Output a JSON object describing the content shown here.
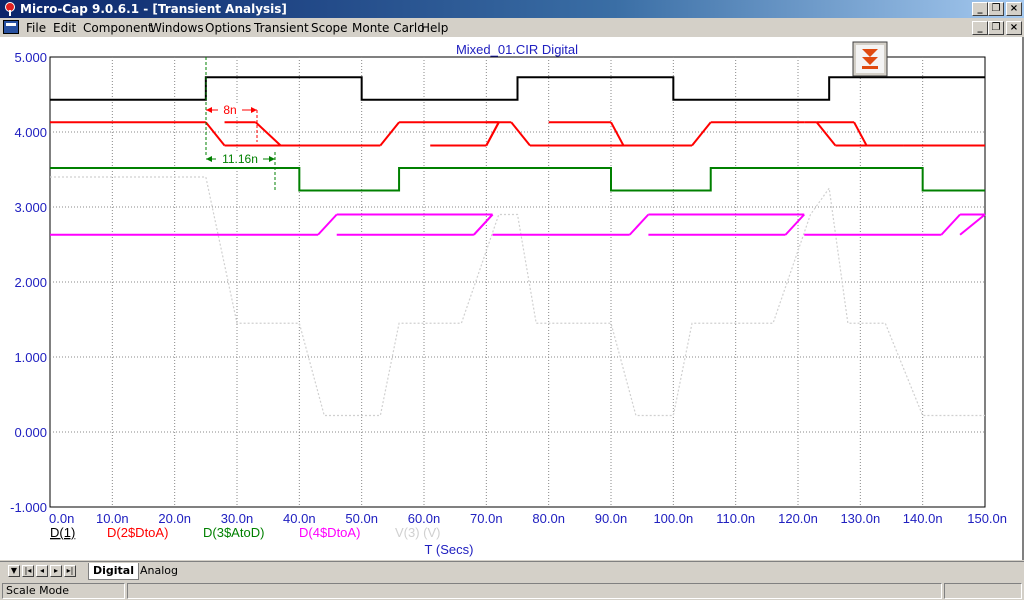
{
  "window": {
    "title": "Micro-Cap 9.0.6.1 - [Transient Analysis]"
  },
  "menu": [
    "File",
    "Edit",
    "Component",
    "Windows",
    "Options",
    "Transient",
    "Scope",
    "Monte Carlo",
    "Help"
  ],
  "plot": {
    "title": "Mixed_01.CIR Digital",
    "x_axis_label": "T (Secs)",
    "legend": [
      {
        "label": "D(1)",
        "color": "#000000"
      },
      {
        "label": "D(2$DtoA)",
        "color": "#ff0000"
      },
      {
        "label": "D(3$AtoD)",
        "color": "#008000"
      },
      {
        "label": "D(4$DtoA)",
        "color": "#ff00ff"
      },
      {
        "label": "V(3) (V)",
        "color": "#d0d0d0"
      }
    ],
    "annotations": {
      "delay1": "8n",
      "delay2": "11.16n"
    }
  },
  "chart_data": {
    "type": "line",
    "title": "Mixed_01.CIR Digital",
    "xlabel": "T (Secs)",
    "ylabel": "",
    "xlim": [
      0,
      150
    ],
    "ylim": [
      -1,
      5
    ],
    "x_ticks": [
      "0.0n",
      "10.0n",
      "20.0n",
      "30.0n",
      "40.0n",
      "50.0n",
      "60.0n",
      "70.0n",
      "80.0n",
      "90.0n",
      "100.0n",
      "110.0n",
      "120.0n",
      "130.0n",
      "140.0n",
      "150.0n"
    ],
    "y_ticks": [
      "5.000",
      "4.000",
      "3.000",
      "2.000",
      "1.000",
      "0.000",
      "-1.000"
    ],
    "grid": true,
    "series": [
      {
        "name": "D(1)",
        "color": "#000000",
        "x": [
          0,
          25,
          25,
          50,
          50,
          75,
          75,
          100,
          100,
          125,
          125,
          150
        ],
        "y": [
          4.43,
          4.43,
          4.73,
          4.73,
          4.43,
          4.43,
          4.73,
          4.73,
          4.43,
          4.43,
          4.73,
          4.73
        ]
      },
      {
        "name": "D(2$DtoA)",
        "color": "#ff0000",
        "dual": true,
        "x": [
          0,
          25,
          28,
          33,
          37,
          40,
          53,
          56,
          61,
          70,
          72,
          74,
          77,
          80,
          90,
          100,
          103,
          106,
          120,
          123,
          126,
          129,
          137,
          139,
          144,
          150
        ],
        "hi": [
          4.13,
          4.13,
          4.13,
          4.13,
          4.13,
          4.13,
          4.13,
          4.13,
          4.13,
          4.13,
          4.13,
          4.13,
          4.13,
          4.13,
          4.13,
          4.13,
          4.13,
          4.13,
          4.13,
          4.13,
          4.13,
          4.13,
          4.13,
          4.13,
          4.13,
          4.13
        ]
      },
      {
        "name": "D(3$AtoD)",
        "color": "#008000",
        "x": [
          0,
          40,
          40,
          56,
          56,
          90,
          90,
          106,
          106,
          140,
          140,
          150
        ],
        "y": [
          3.52,
          3.52,
          3.22,
          3.22,
          3.52,
          3.52,
          3.22,
          3.22,
          3.52,
          3.52,
          3.22,
          3.22
        ]
      },
      {
        "name": "D(4$DtoA)",
        "color": "#ff00ff",
        "dual": true,
        "x": [
          0,
          43,
          71,
          121,
          150
        ],
        "hi": [
          2.9,
          2.9,
          2.9,
          2.9,
          2.9
        ]
      },
      {
        "name": "V(3) (V)",
        "color": "#d0d0d0",
        "x": [
          0,
          25,
          30,
          40,
          44,
          50,
          53,
          56,
          60,
          66,
          72,
          75,
          78,
          84,
          90,
          94,
          100,
          103,
          106,
          110,
          116,
          122,
          125,
          128,
          134,
          140,
          144,
          150
        ],
        "y": [
          3.4,
          3.4,
          1.45,
          1.45,
          0.22,
          0.22,
          0.22,
          1.45,
          1.45,
          1.45,
          2.9,
          2.9,
          1.45,
          1.45,
          1.45,
          0.22,
          0.22,
          1.45,
          1.45,
          1.45,
          1.45,
          2.9,
          3.25,
          1.45,
          1.45,
          0.22,
          0.22,
          0.22
        ]
      }
    ]
  },
  "tabs": [
    "Digital",
    "Analog"
  ],
  "active_tab": "Digital",
  "status": {
    "mode": "Scale Mode"
  }
}
